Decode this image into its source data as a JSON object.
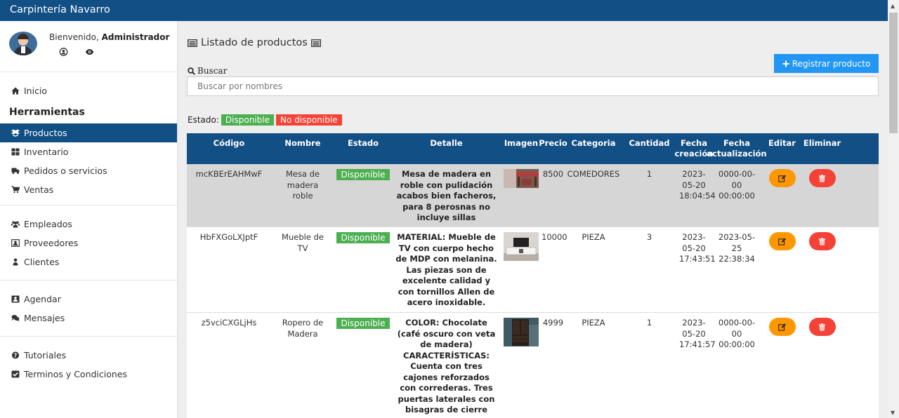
{
  "app": {
    "brand": "Carpintería Navarro"
  },
  "profile": {
    "welcome": "Bienvenido,",
    "user": "Administrador",
    "icons": [
      "user-circle-icon",
      "eye-icon"
    ]
  },
  "sidebar": {
    "items_group1": [
      {
        "label": "Inicio",
        "icon": "home-icon"
      }
    ],
    "heading": "Herramientas",
    "items_tools": [
      {
        "label": "Productos",
        "icon": "products-icon",
        "active": true
      },
      {
        "label": "Inventario",
        "icon": "grid-icon"
      },
      {
        "label": "Pedidos o servicios",
        "icon": "truck-icon"
      },
      {
        "label": "Ventas",
        "icon": "cart-icon"
      }
    ],
    "items_people": [
      {
        "label": "Empleados",
        "icon": "users-icon"
      },
      {
        "label": "Proveedores",
        "icon": "contact-card-icon"
      },
      {
        "label": "Clientes",
        "icon": "user-icon"
      }
    ],
    "items_comm": [
      {
        "label": "Agendar",
        "icon": "address-book-icon"
      },
      {
        "label": "Mensajes",
        "icon": "comments-icon"
      }
    ],
    "items_help": [
      {
        "label": "Tutoriales",
        "icon": "question-circle-icon"
      },
      {
        "label": "Terminos y Condiciones",
        "icon": "check-square-icon"
      }
    ]
  },
  "main": {
    "title": "Listado de productos",
    "register_label": "Registrar producto",
    "search_label": "Buscar",
    "search_placeholder": "Buscar por nombres",
    "search_value": "",
    "estado_label": "Estado:",
    "estado_available": "Disponible",
    "estado_unavailable": "No disponible",
    "colors": {
      "header": "#124f85",
      "available": "#4caf50",
      "unavailable": "#f44336",
      "edit": "#ff9800",
      "delete": "#f44336",
      "primary": "#2196f3"
    }
  },
  "table": {
    "headers": {
      "code": "Código",
      "name": "Nombre",
      "status": "Estado",
      "detail": "Detalle",
      "image": "Imagen",
      "price": "Precio",
      "category": "Categoria",
      "quantity": "Cantidad",
      "created_1": "Fecha",
      "created_2": "creación",
      "updated_1": "Fecha",
      "updated_2": "actualización",
      "edit": "Editar",
      "delete": "Eliminar"
    },
    "rows": [
      {
        "code": "mcKBErEAHMwF",
        "name": "Mesa de madera roble",
        "status": "Disponible",
        "detail": "Mesa de madera en roble con pulidación acabos bien facheros, para 8 perosnas no incluye sillas",
        "image": "table-photo",
        "price": "8500",
        "category": "COMEDORES",
        "quantity": "1",
        "created": "2023-05-20 18:04:54",
        "updated": "0000-00-00 00:00:00"
      },
      {
        "code": "HbFXGoLXJptF",
        "name": "Mueble de TV",
        "status": "Disponible",
        "detail": "MATERIAL: Mueble de TV con cuerpo hecho de MDP con melanina. Las piezas son de excelente calidad y con tornillos Allen de acero inoxidable.",
        "image": "tv-furniture-photo",
        "price": "10000",
        "category": "PIEZA",
        "quantity": "3",
        "created": "2023-05-20 17:43:51",
        "updated": "2023-05-25 22:38:34"
      },
      {
        "code": "z5vciCXGLjHs",
        "name": "Ropero de Madera",
        "status": "Disponible",
        "detail": "COLOR: Chocolate (café oscuro con veta de madera) CARACTERÍSTICAS: Cuenta con tres cajones reforzados con correderas. Tres puertas laterales con bisagras de cierre",
        "image": "wardrobe-photo",
        "price": "4999",
        "category": "PIEZA",
        "quantity": "1",
        "created": "2023-05-20 17:41:57",
        "updated": "0000-00-00 00:00:00"
      }
    ]
  }
}
